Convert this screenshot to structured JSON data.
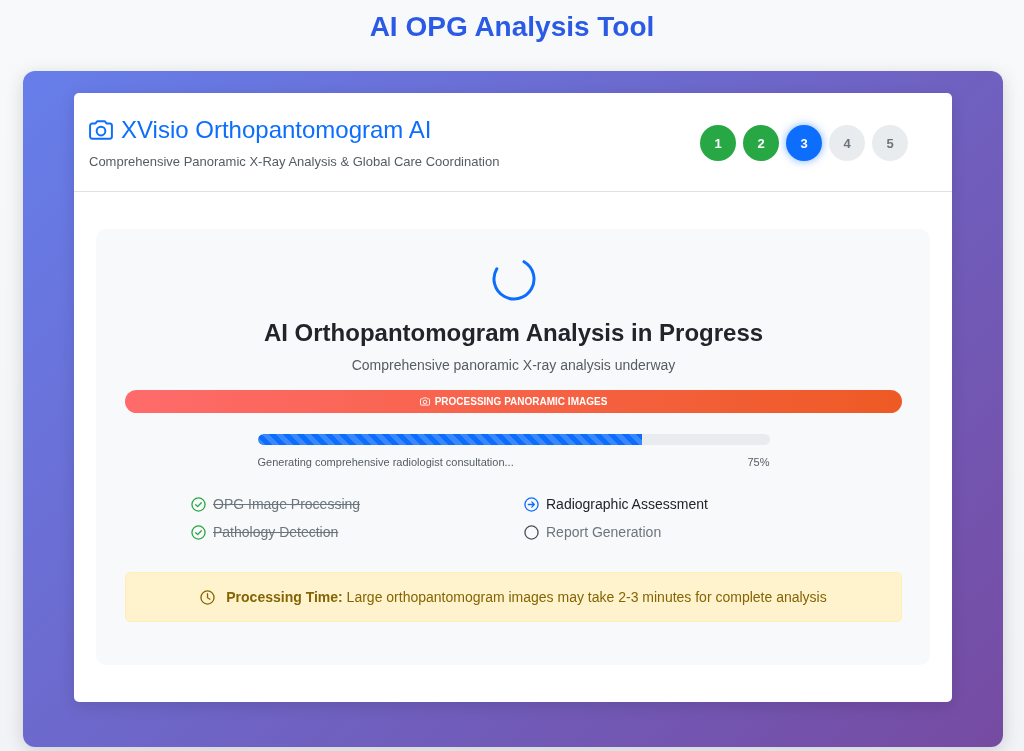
{
  "page_title": "AI OPG Analysis Tool",
  "header": {
    "title": "XVisio Orthopantomogram AI",
    "subtitle": "Comprehensive Panoramic X-Ray Analysis & Global Care Coordination"
  },
  "steps": [
    {
      "label": "1",
      "completed": true,
      "active": false
    },
    {
      "label": "2",
      "completed": true,
      "active": false
    },
    {
      "label": "3",
      "completed": false,
      "active": true
    },
    {
      "label": "4",
      "completed": false,
      "active": false
    },
    {
      "label": "5",
      "completed": false,
      "active": false
    }
  ],
  "progress": {
    "title": "AI Orthopantomogram Analysis in Progress",
    "subtitle": "Comprehensive panoramic X-ray analysis underway",
    "banner": "PROCESSING PANORAMIC IMAGES",
    "level": 0.75,
    "status_text": "Generating comprehensive radiologist consultation...",
    "percent": "75%"
  },
  "tasks": [
    {
      "label": "OPG Image Processing",
      "completed": true,
      "active": false
    },
    {
      "label": "Pathology Detection",
      "completed": true,
      "active": false
    },
    {
      "label": "Radiographic Assessment",
      "completed": false,
      "active": true
    },
    {
      "label": "Report Generation",
      "completed": false,
      "active": false
    }
  ],
  "notice": {
    "text": "**Processing Time:** Large orthopantomogram images may take 2-3 minutes for complete analysis"
  }
}
